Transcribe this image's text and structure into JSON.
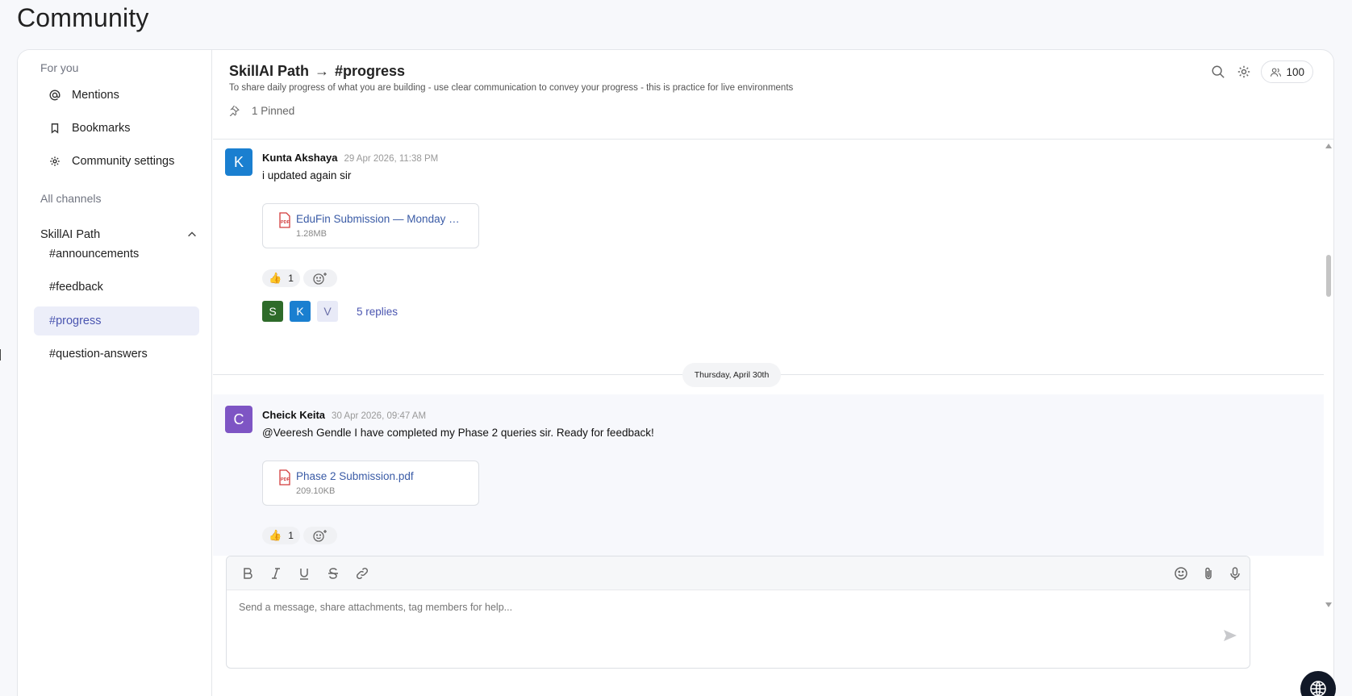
{
  "page": {
    "title": "Community"
  },
  "sidebar": {
    "for_you_label": "For you",
    "for_you_items": [
      {
        "label": "Mentions",
        "icon": "at-icon"
      },
      {
        "label": "Bookmarks",
        "icon": "bookmark-icon"
      },
      {
        "label": "Community settings",
        "icon": "gear-icon"
      }
    ],
    "all_channels_label": "All channels",
    "group": {
      "label": "SkillAI Path",
      "icon": "chevron-up-icon"
    },
    "channels": [
      {
        "label": "#announcements",
        "active": false
      },
      {
        "label": "#feedback",
        "active": false
      },
      {
        "label": "#progress",
        "active": true
      },
      {
        "label": "#question-answers",
        "active": false
      }
    ]
  },
  "channel": {
    "group_name": "SkillAI Path",
    "arrow": "→",
    "name": "#progress",
    "description": "To share daily progress of what you are building - use clear communication to convey your progress - this is practice for live environments",
    "pinned_label": "1 Pinned",
    "member_count": "100"
  },
  "messages": [
    {
      "avatar_letter": "K",
      "avatar_color": "#1a7fd0",
      "author": "Kunta Akshaya",
      "time": "29 Apr 2026, 11:38 PM",
      "text": "i updated again sir",
      "attachment": {
        "name": "EduFin Submission — Monday  …",
        "size": "1.28MB"
      },
      "reaction": {
        "emoji": "👍",
        "count": "1"
      },
      "reply_avatars": [
        {
          "letter": "S",
          "color": "#2e6b2a",
          "text_color": "#ffffff"
        },
        {
          "letter": "K",
          "color": "#1a7fd0",
          "text_color": "#ffffff"
        },
        {
          "letter": "V",
          "color": "#e8eaf7",
          "text_color": "#6a6fa8"
        }
      ],
      "replies_label": "5 replies"
    },
    {
      "avatar_letter": "C",
      "avatar_color": "#7e55c4",
      "author": "Cheick Keita",
      "time": "30 Apr 2026, 09:47 AM",
      "text": "@Veeresh Gendle I have completed my Phase 2 queries sir. Ready for feedback!",
      "attachment": {
        "name": "Phase 2 Submission.pdf",
        "size": "209.10KB"
      },
      "reaction": {
        "emoji": "👍",
        "count": "1"
      }
    }
  ],
  "date_divider": "Thursday, April 30th",
  "composer": {
    "placeholder": "Send a message, share attachments, tag members for help..."
  },
  "colors": {
    "accent": "#4a55b0",
    "active_channel_bg": "#eceef9",
    "link": "#3a5ba6"
  }
}
